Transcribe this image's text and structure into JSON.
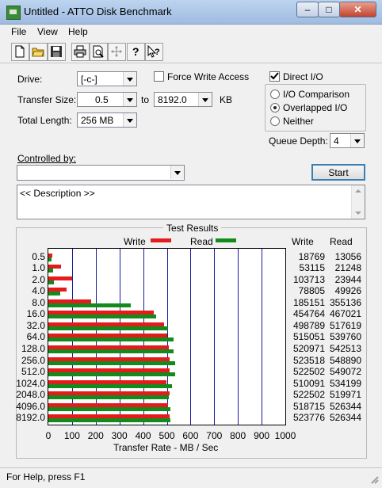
{
  "window": {
    "title": "Untitled - ATTO Disk Benchmark",
    "min_glyph": "–",
    "max_glyph": "□",
    "close_glyph": "✕"
  },
  "menu": [
    "File",
    "View",
    "Help"
  ],
  "toolbar": [
    "new-document",
    "open-folder",
    "save-disk",
    "print",
    "print-preview",
    "move",
    "help-question",
    "context-help"
  ],
  "drive": {
    "label": "Drive:",
    "value": "[-c-]"
  },
  "transfer_size": {
    "label": "Transfer Size:",
    "from": "0.5",
    "to_label": "to",
    "to": "8192.0",
    "unit": "KB"
  },
  "total_length": {
    "label": "Total Length:",
    "value": "256 MB"
  },
  "force_write": {
    "label": "Force Write Access",
    "checked": false
  },
  "direct_io": {
    "label": "Direct I/O",
    "checked": true
  },
  "io_mode": {
    "options": [
      "I/O Comparison",
      "Overlapped I/O",
      "Neither"
    ],
    "selected": "Overlapped I/O"
  },
  "queue_depth": {
    "label": "Queue Depth:",
    "value": "4"
  },
  "controlled_by": {
    "label": "Controlled by:",
    "value": ""
  },
  "start_button": "Start",
  "description": "<< Description >>",
  "results": {
    "title": "Test Results",
    "legend": {
      "write": "Write",
      "read": "Read",
      "write_color": "#e41b1b",
      "read_color": "#138a1c"
    },
    "col_write": "Write",
    "col_read": "Read"
  },
  "chart_data": {
    "type": "bar",
    "orientation": "horizontal",
    "categories": [
      "0.5",
      "1.0",
      "2.0",
      "4.0",
      "8.0",
      "16.0",
      "32.0",
      "64.0",
      "128.0",
      "256.0",
      "512.0",
      "1024.0",
      "2048.0",
      "4096.0",
      "8192.0"
    ],
    "series": [
      {
        "name": "Write",
        "values": [
          18769,
          53115,
          103713,
          78805,
          185151,
          454764,
          498789,
          515051,
          520971,
          523518,
          522502,
          510091,
          522502,
          518715,
          523776
        ]
      },
      {
        "name": "Read",
        "values": [
          13056,
          21248,
          23944,
          49926,
          355136,
          467021,
          517619,
          539760,
          542513,
          548890,
          549072,
          534199,
          519971,
          526344,
          526344
        ]
      }
    ],
    "xlabel": "Transfer Rate - MB / Sec",
    "xlim": [
      0,
      1000
    ],
    "xticks": [
      "0",
      "100",
      "200",
      "300",
      "400",
      "500",
      "600",
      "700",
      "800",
      "900",
      "1000"
    ],
    "grid": true,
    "legend_position": "top"
  },
  "status": "For Help, press F1"
}
